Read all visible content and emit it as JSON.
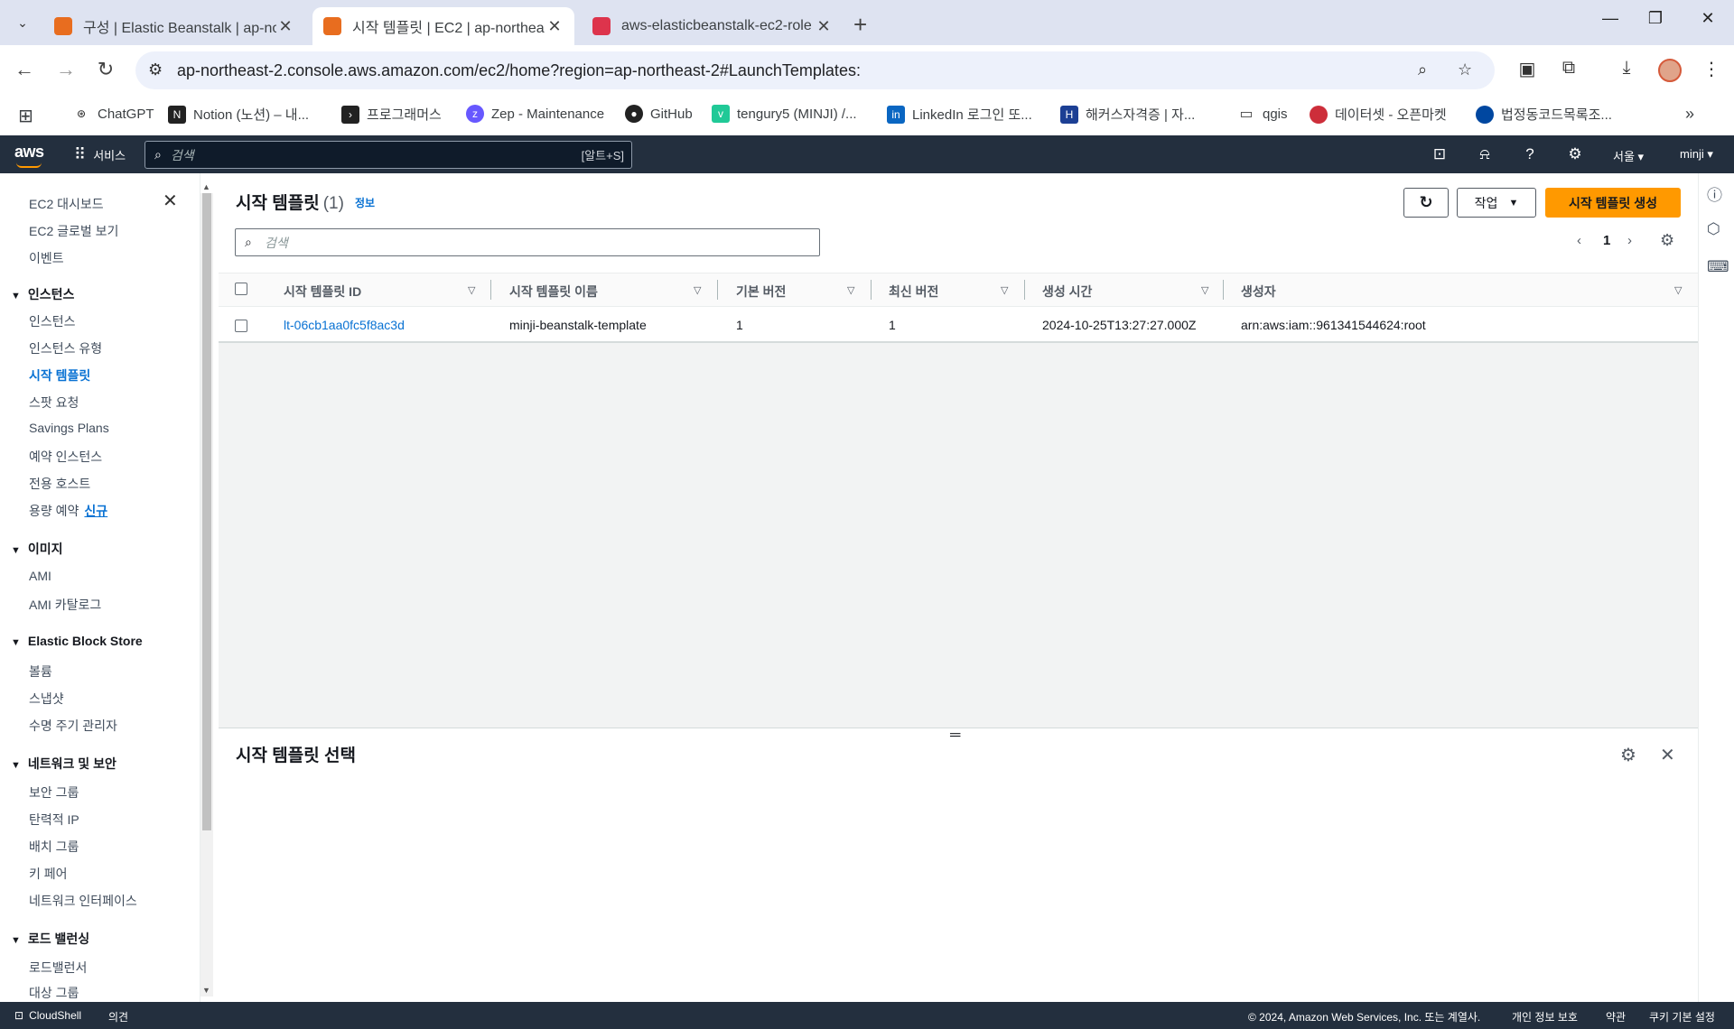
{
  "browser": {
    "tabs": [
      {
        "title": "구성 | Elastic Beanstalk | ap-no",
        "color": "#e86d1f"
      },
      {
        "title": "시작 템플릿 | EC2 | ap-northea",
        "color": "#e86d1f"
      },
      {
        "title": "aws-elasticbeanstalk-ec2-role",
        "color": "#dd344c"
      }
    ],
    "url": "ap-northeast-2.console.aws.amazon.com/ec2/home?region=ap-northeast-2#LaunchTemplates:",
    "bookmarks": [
      "ChatGPT",
      "Notion (노션) – 내...",
      "프로그래머스",
      "Zep - Maintenance",
      "GitHub",
      "tengury5 (MINJI) /...",
      "LinkedIn 로그인 또...",
      "해커스자격증 | 자...",
      "qgis",
      "데이터셋 - 오픈마켓",
      "법정동코드목록조..."
    ]
  },
  "aws_header": {
    "logo": "aws",
    "services": "서비스",
    "search_placeholder": "검색",
    "search_shortcut": "[알트+S]",
    "region": "서울 ▾",
    "user": "minji ▾"
  },
  "sidenav": {
    "top_items": [
      "EC2 대시보드",
      "EC2 글로벌 보기",
      "이벤트"
    ],
    "sections": [
      {
        "title": "인스턴스",
        "items": [
          "인스턴스",
          "인스턴스 유형",
          "시작 템플릿",
          "스팟 요청",
          "Savings Plans",
          "예약 인스턴스",
          "전용 호스트",
          "용량 예약"
        ]
      },
      {
        "title": "이미지",
        "items": [
          "AMI",
          "AMI 카탈로그"
        ]
      },
      {
        "title": "Elastic Block Store",
        "items": [
          "볼륨",
          "스냅샷",
          "수명 주기 관리자"
        ]
      },
      {
        "title": "네트워크 및 보안",
        "items": [
          "보안 그룹",
          "탄력적 IP",
          "배치 그룹",
          "키 페어",
          "네트워크 인터페이스"
        ]
      },
      {
        "title": "로드 밸런싱",
        "items": [
          "로드밸런서",
          "대상 그룹"
        ]
      }
    ],
    "new_badge": "신규"
  },
  "main": {
    "title": "시작 템플릿",
    "count": "(1)",
    "info": "정보",
    "actions_label": "작업",
    "create_label": "시작 템플릿 생성",
    "search_placeholder": "검색",
    "page": "1",
    "columns": [
      "시작 템플릿 ID",
      "시작 템플릿 이름",
      "기본 버전",
      "최신 버전",
      "생성 시간",
      "생성자"
    ],
    "rows": [
      {
        "id": "lt-06cb1aa0fc5f8ac3d",
        "name": "minji-beanstalk-template",
        "default_version": "1",
        "latest_version": "1",
        "created": "2024-10-25T13:27:27.000Z",
        "owner": "arn:aws:iam::961341544624:root"
      }
    ]
  },
  "detail": {
    "title": "시작 템플릿 선택"
  },
  "footer": {
    "cloudshell": "CloudShell",
    "feedback": "의견",
    "copyright": "© 2024, Amazon Web Services, Inc. 또는 계열사.",
    "privacy": "개인 정보 보호",
    "terms": "약관",
    "cookies": "쿠키 기본 설정"
  }
}
